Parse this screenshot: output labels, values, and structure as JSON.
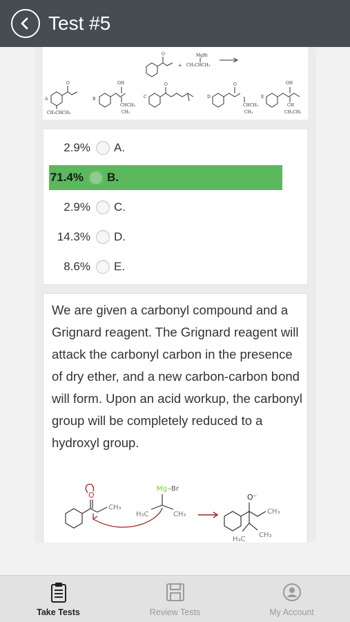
{
  "header": {
    "title": "Test #5",
    "back_icon": "back-arrow-icon"
  },
  "question_figure": {
    "reagent_top": "MgBr",
    "reagent_bottom": "CH₃CHCH₃",
    "labels": [
      "A",
      "B",
      "C",
      "D",
      "E"
    ],
    "group_a": "CH₃CHCH₃",
    "group_b1": "CHCH₃",
    "group_b2": "CH₃",
    "group_d1": "CHCH₃",
    "group_d2": "CH₃",
    "group_e1": "CH",
    "group_e2": "CH₂CH₃",
    "oh": "OH",
    "o": "O"
  },
  "answers": [
    {
      "percent": "2.9%",
      "letter": "A.",
      "selected": false
    },
    {
      "percent": "71.4%",
      "letter": "B.",
      "selected": true
    },
    {
      "percent": "2.9%",
      "letter": "C.",
      "selected": false
    },
    {
      "percent": "14.3%",
      "letter": "D.",
      "selected": false
    },
    {
      "percent": "8.6%",
      "letter": "E.",
      "selected": false
    }
  ],
  "explanation": {
    "text": "We are given a carbonyl compound and a Grignard reagent. The Grignard reagent will attack the carbonyl carbon in the presence of dry ether, and a new carbon-carbon bond will form. Upon an acid workup, the carbonyl group will be completely reduced to a hydroxyl group."
  },
  "mechanism": {
    "o": "O",
    "mg_label": "Mg",
    "br_label": "–Br",
    "ch3": "CH₃",
    "h3c": "H₃C",
    "o_minus": "O⁻",
    "colors": {
      "arrow": "#a02020",
      "mg": "#7ed321"
    }
  },
  "nav": {
    "items": [
      {
        "label": "Take Tests",
        "icon": "clipboard-icon",
        "active": true
      },
      {
        "label": "Review Tests",
        "icon": "save-disk-icon",
        "active": false
      },
      {
        "label": "My Account",
        "icon": "account-icon",
        "active": false
      }
    ]
  }
}
